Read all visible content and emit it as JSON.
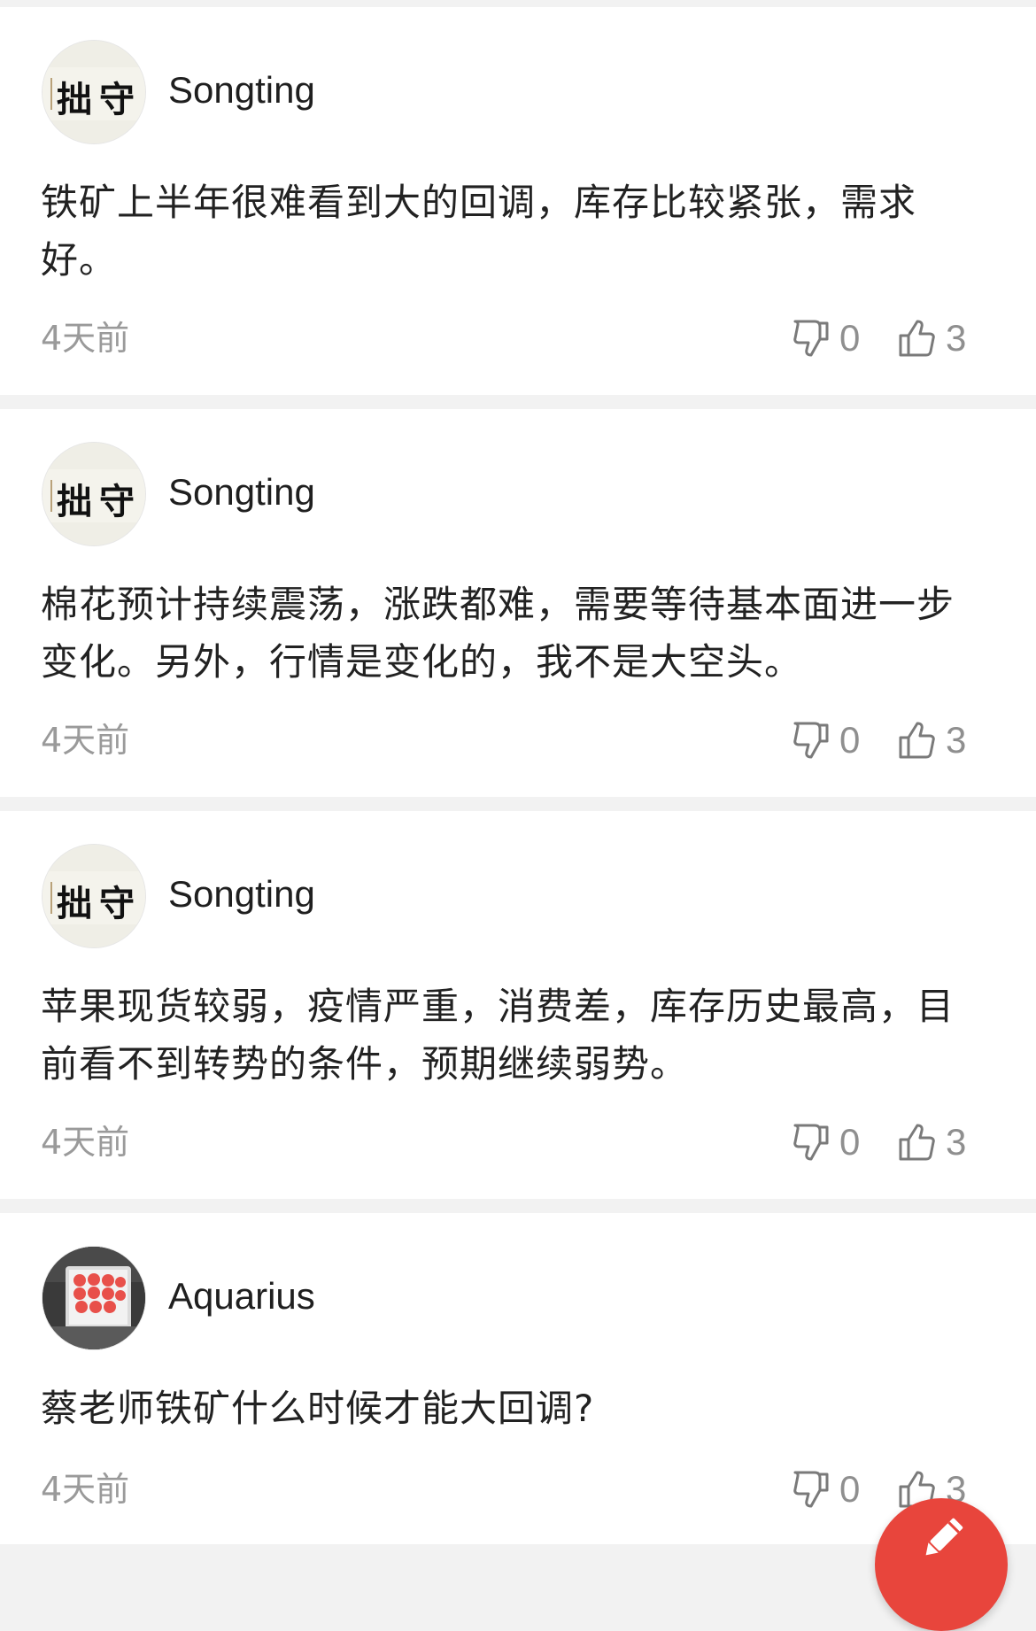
{
  "comments": [
    {
      "username": "Songting",
      "avatar_text": "拙 守",
      "avatar_icon": "calligraphy-avatar",
      "text": "铁矿上半年很难看到大的回调，库存比较紧张，需求好。",
      "time": "4天前",
      "dislikes": "0",
      "likes": "3"
    },
    {
      "username": "Songting",
      "avatar_text": "拙 守",
      "avatar_icon": "calligraphy-avatar",
      "text": "棉花预计持续震荡，涨跌都难，需要等待基本面进一步变化。另外，行情是变化的，我不是大空头。",
      "time": "4天前",
      "dislikes": "0",
      "likes": "3"
    },
    {
      "username": "Songting",
      "avatar_text": "拙 守",
      "avatar_icon": "calligraphy-avatar",
      "text": "苹果现货较弱，疫情严重，消费差，库存历史最高，目前看不到转势的条件，预期继续弱势。",
      "time": "4天前",
      "dislikes": "0",
      "likes": "3"
    },
    {
      "username": "Aquarius",
      "avatar_icon": "photo-avatar",
      "text": "蔡老师铁矿什么时候才能大回调?",
      "time": "4天前",
      "dislikes": "0",
      "likes": "3"
    }
  ],
  "icons": {
    "dislike": "thumbs-down-icon",
    "like": "thumbs-up-icon",
    "compose": "pencil-icon"
  },
  "colors": {
    "fab": "#e8453c",
    "background": "#f2f2f2",
    "meta_text": "#9a9a9a"
  }
}
